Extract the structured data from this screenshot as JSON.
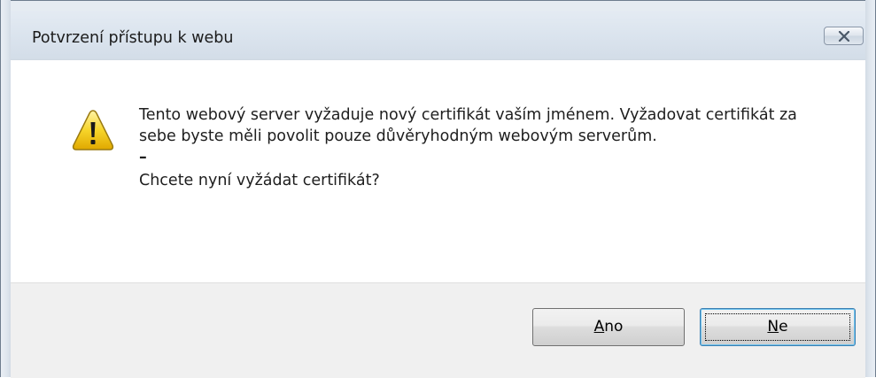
{
  "dialog": {
    "title": "Potvrzení přístupu k webu",
    "message": "Tento webový server vyžaduje nový certifikát vaším jménem. Vyžadovat certifikát za sebe byste měli povolit pouze důvěryhodným webovým serverům.",
    "separator": "–",
    "question": "Chcete nyní vyžádat certifikát?",
    "icon": "warning-icon"
  },
  "buttons": {
    "yes_label_mnemonic": "A",
    "yes_label_rest": "no",
    "no_label_mnemonic": "N",
    "no_label_rest": "e"
  },
  "colors": {
    "title_bar": "#dbe4ee",
    "footer": "#f0f0f0",
    "warning_yellow": "#f7d52a"
  }
}
